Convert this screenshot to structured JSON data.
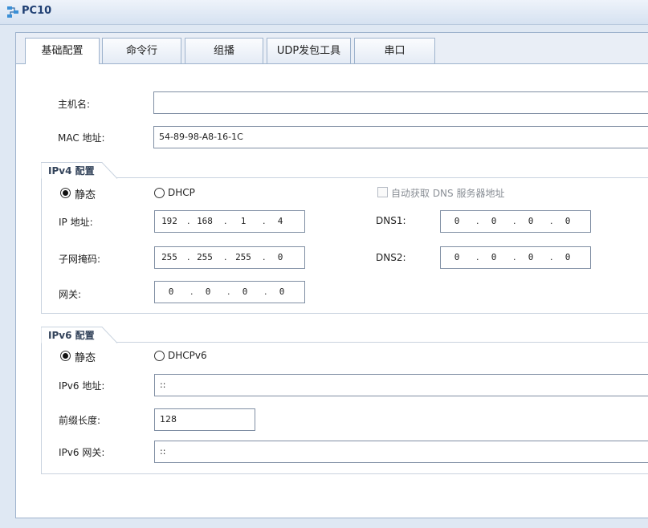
{
  "window": {
    "title": "PC10"
  },
  "tabs": [
    {
      "label": "基础配置",
      "active": true
    },
    {
      "label": "命令行",
      "active": false
    },
    {
      "label": "组播",
      "active": false
    },
    {
      "label": "UDP发包工具",
      "active": false
    },
    {
      "label": "串口",
      "active": false
    }
  ],
  "basic": {
    "hostname_label": "主机名:",
    "hostname_value": "",
    "mac_label": "MAC 地址:",
    "mac_value": "54-89-98-A8-16-1C"
  },
  "ipv4": {
    "section_title": "IPv4 配置",
    "static_label": "静态",
    "static_selected": true,
    "dhcp_label": "DHCP",
    "auto_dns_label": "自动获取 DNS 服务器地址",
    "auto_dns_checked": false,
    "ip_label": "IP 地址:",
    "ip": [
      "192",
      "168",
      "1",
      "4"
    ],
    "mask_label": "子网掩码:",
    "mask": [
      "255",
      "255",
      "255",
      "0"
    ],
    "gateway_label": "网关:",
    "gateway": [
      "0",
      "0",
      "0",
      "0"
    ],
    "dns1_label": "DNS1:",
    "dns1": [
      "0",
      "0",
      "0",
      "0"
    ],
    "dns2_label": "DNS2:",
    "dns2": [
      "0",
      "0",
      "0",
      "0"
    ]
  },
  "ipv6": {
    "section_title": "IPv6 配置",
    "static_label": "静态",
    "static_selected": true,
    "dhcp_label": "DHCPv6",
    "addr_label": "IPv6 地址:",
    "addr_value": "::",
    "prefix_label": "前缀长度:",
    "prefix_value": "128",
    "gw_label": "IPv6 网关:",
    "gw_value": "::"
  },
  "colors": {
    "accent": "#1f3f73",
    "border": "#9eb3cd",
    "background": "#dfe8f3"
  }
}
